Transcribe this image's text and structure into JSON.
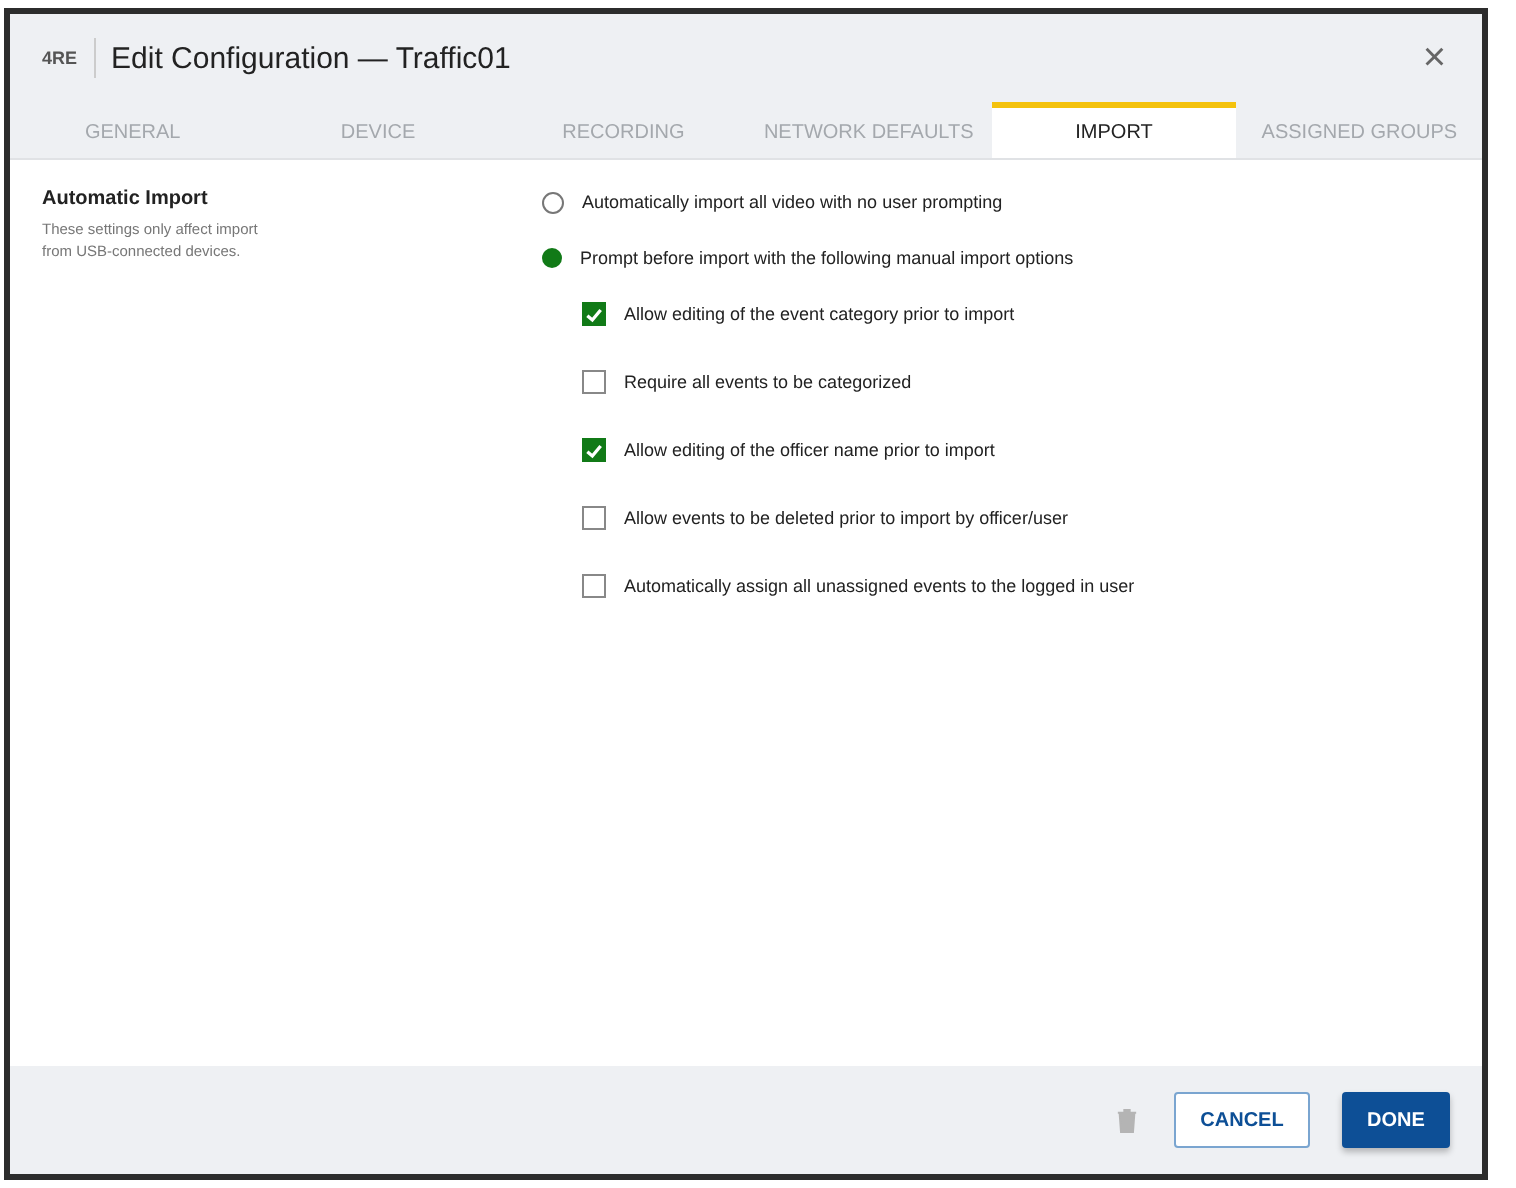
{
  "dialog": {
    "logo": "4RE",
    "title": "Edit Configuration — Traffic01",
    "close": "×"
  },
  "tabs": [
    {
      "label": "GENERAL",
      "selected": false
    },
    {
      "label": "DEVICE",
      "selected": false
    },
    {
      "label": "RECORDING",
      "selected": false
    },
    {
      "label": "NETWORK DEFAULTS",
      "selected": false
    },
    {
      "label": "IMPORT",
      "selected": true
    },
    {
      "label": "ASSIGNED GROUPS",
      "selected": false
    }
  ],
  "section": {
    "title": "Automatic Import",
    "description": "These settings only affect import from USB-connected devices."
  },
  "import_modes": [
    {
      "label": "Automatically import all video with no user prompting",
      "selected": false
    },
    {
      "label": "Prompt before import with the following manual import options",
      "selected": true
    }
  ],
  "options": [
    {
      "label": "Allow editing of the event category prior to import",
      "checked": true
    },
    {
      "label": "Require all events to be categorized",
      "checked": false
    },
    {
      "label": "Allow editing of the officer name prior to import",
      "checked": true
    },
    {
      "label": "Allow events to be deleted prior to import by officer/user",
      "checked": false
    },
    {
      "label": "Automatically assign all unassigned events to the logged in user",
      "checked": false
    }
  ],
  "buttons": [
    {
      "label": "CANCEL",
      "kind": "secondary"
    },
    {
      "label": "DONE",
      "kind": "primary"
    }
  ]
}
